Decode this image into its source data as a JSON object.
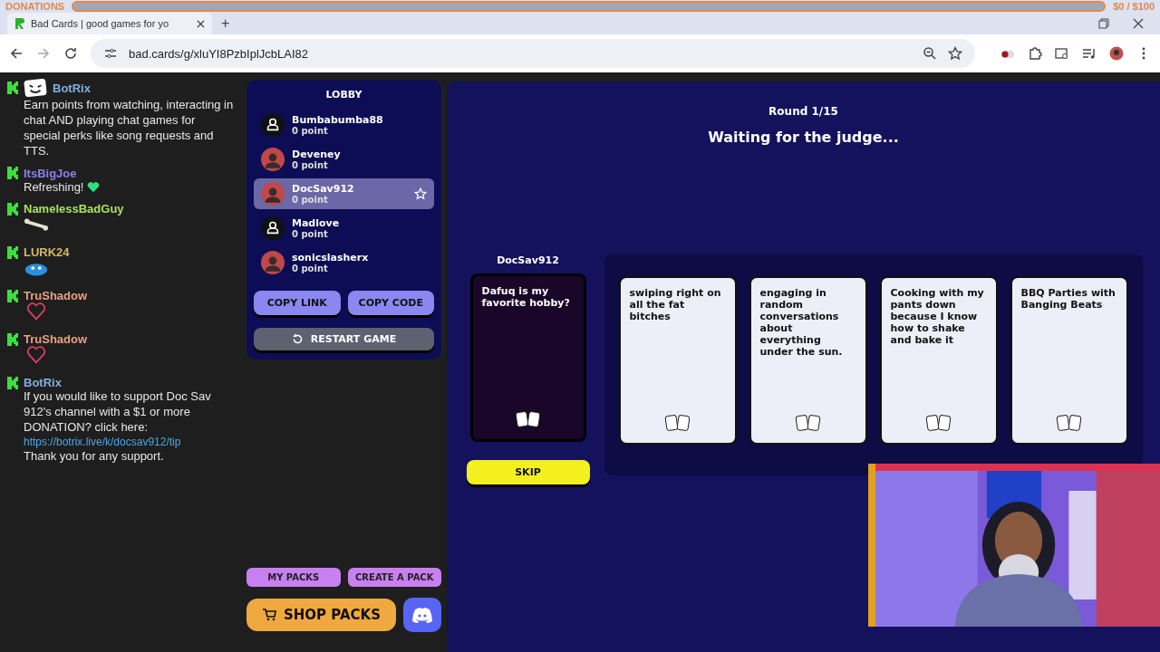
{
  "overlay": {
    "donations_label": "DONATIONS",
    "donations_amount": "$0  / $100",
    "level": 0
  },
  "browser": {
    "tab_title": "Bad Cards | good games for yo",
    "new_tab": "+",
    "url": "bad.cards/g/xluYI8PzbIplJcbLAI82"
  },
  "chat": [
    {
      "user": "BotRix",
      "color": "#80b0e0",
      "kind": "bot",
      "text": "Earn points from watching, interacting in chat AND playing chat games for special perks like song requests and TTS."
    },
    {
      "user": "ItsBigJoe",
      "color": "#8a80e8",
      "kind": "text",
      "text": "Refreshing!",
      "emote": {
        "kind": "heart-green"
      }
    },
    {
      "user": "NamelessBadGuy",
      "color": "#a8e060",
      "kind": "emote",
      "emote": {
        "kind": "bone"
      }
    },
    {
      "user": "LURK24",
      "color": "#d8b860",
      "kind": "emote",
      "emote": {
        "kind": "blob"
      }
    },
    {
      "user": "TruShadow",
      "color": "#e8a080",
      "kind": "emote",
      "emote": {
        "kind": "heart-outline"
      }
    },
    {
      "user": "TruShadow",
      "color": "#e8a080",
      "kind": "emote",
      "emote": {
        "kind": "heart-outline"
      }
    },
    {
      "user": "BotRix",
      "color": "#80b0e0",
      "kind": "link",
      "text": "If you would like to support Doc Sav 912's channel with a $1 or more DONATION? click here:",
      "link": "https://botrix.live/k/docsav912/tip",
      "after": "Thank you for any support."
    }
  ],
  "lobby": {
    "title": "LOBBY",
    "players": [
      {
        "name": "Bumbabumba88",
        "points": "0 point",
        "kind": "default",
        "selected": false
      },
      {
        "name": "Deveney",
        "points": "0 point",
        "selected": false
      },
      {
        "name": "DocSav912",
        "points": "0 point",
        "selected": true
      },
      {
        "name": "Madlove",
        "points": "0 point",
        "kind": "default",
        "selected": false
      },
      {
        "name": "sonicslasherx",
        "points": "0 point",
        "selected": false
      }
    ],
    "buttons": [
      "COPY LINK",
      "COPY CODE"
    ],
    "restart": "RESTART GAME",
    "pack_buttons": [
      "MY PACKS",
      "CREATE A PACK"
    ],
    "shop": "SHOP PACKS"
  },
  "game": {
    "round": "Round 1/15",
    "status": "Waiting for the judge...",
    "judge": "DocSav912",
    "question": "Dafuq is my favorite hobby?",
    "skip": "SKIP",
    "answers": [
      "swiping right on all the fat bitches",
      "engaging in random conversations about everything under the sun.",
      "Cooking with my pants down because I know how to shake and bake it",
      "BBQ Parties with Banging Beats"
    ]
  }
}
